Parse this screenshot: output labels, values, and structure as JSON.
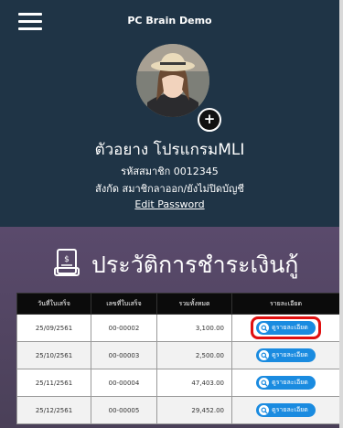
{
  "header": {
    "app_title": "PC Brain Demo",
    "member_name": "ตัวอยาง โปรแกรมMLI",
    "member_code": "รหัสสมาชิก 0012345",
    "member_status": "สังกัด สมาชิกลาออก/ยังไม่ปิดบัญชี",
    "edit_password": "Edit Password"
  },
  "section": {
    "title": "ประวัติการชำระเงินกู้"
  },
  "table": {
    "headers": [
      "วันที่ใบเสร็จ",
      "เลขที่ใบเสร็จ",
      "รวมทั้งหมด",
      "รายละเอียด"
    ],
    "rows": [
      {
        "date": "25/09/2561",
        "receipt": "00-00002",
        "total": "3,100.00",
        "detail": "ดูรายละเอียด"
      },
      {
        "date": "25/10/2561",
        "receipt": "00-00003",
        "total": "2,500.00",
        "detail": "ดูรายละเอียด"
      },
      {
        "date": "25/11/2561",
        "receipt": "00-00004",
        "total": "47,403.00",
        "detail": "ดูรายละเอียด"
      },
      {
        "date": "25/12/2561",
        "receipt": "00-00005",
        "total": "29,452.00",
        "detail": "ดูรายละเอียด"
      }
    ]
  },
  "colors": {
    "header_bg": "#1f3446",
    "section_bg": "#5a4a6c",
    "button": "#1a8be0",
    "highlight": "#e01010"
  }
}
